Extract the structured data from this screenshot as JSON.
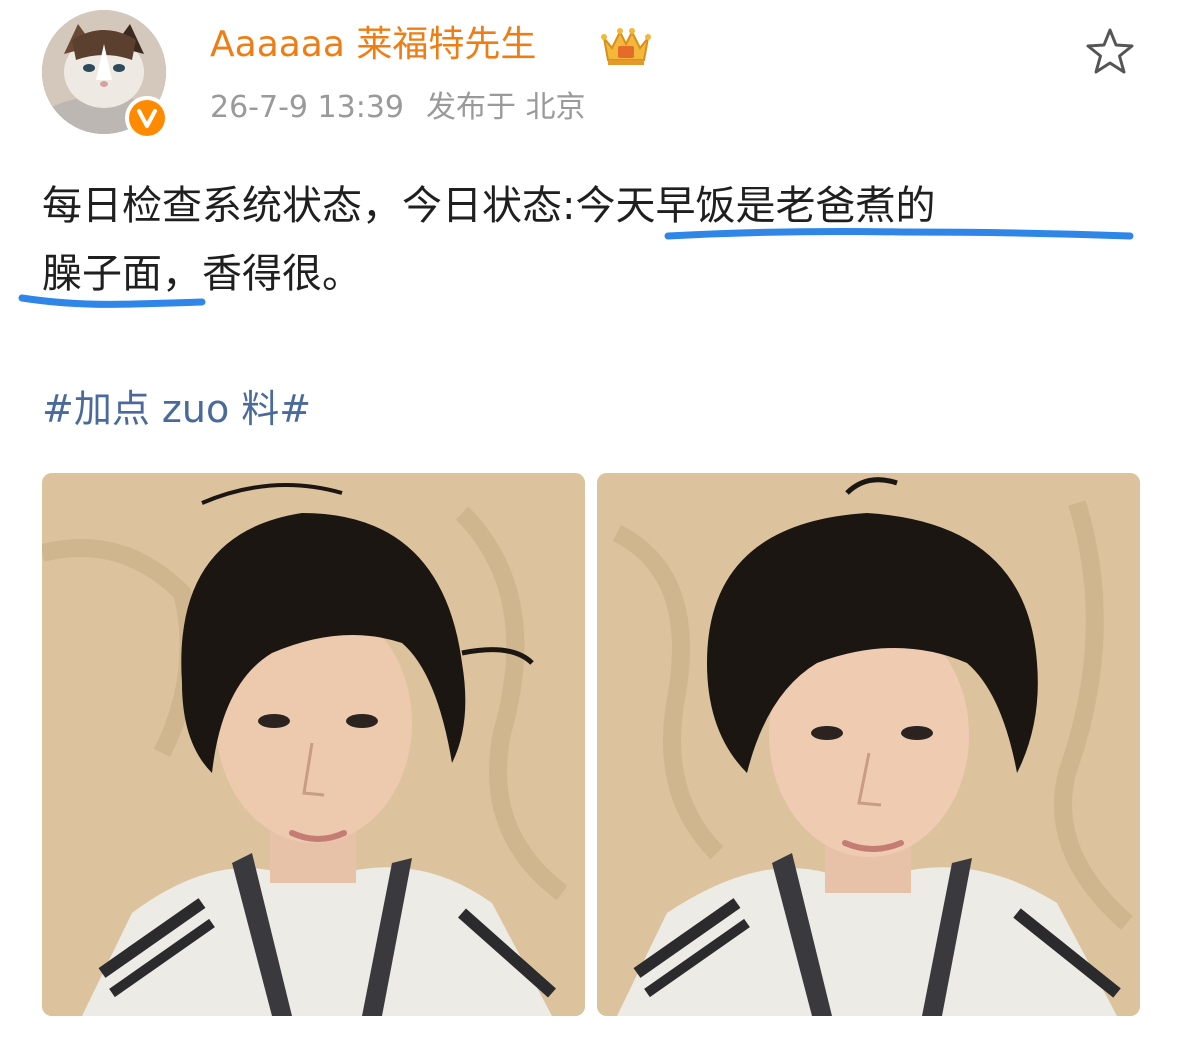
{
  "post": {
    "author": {
      "name": "Aaaaaa 莱福特先生",
      "avatar_icon": "cat-avatar",
      "verified_icon": "verified-v-icon",
      "verified_letter": "V",
      "member_icon": "crown-vip-icon"
    },
    "date": "26-7-9 13:39",
    "location": "发布于 北京",
    "text": {
      "part1": "每日检查系统状态，今日状态:",
      "highlighted_1": "今天早饭是老爸煮的",
      "highlighted_2": "臊子面，",
      "part2": "香得很。"
    },
    "hashtag": "#加点 zuo 料#",
    "images": [
      {
        "description_icon": "selfie-photo"
      },
      {
        "description_icon": "selfie-photo"
      }
    ]
  },
  "colors": {
    "username": "#f07d14",
    "meta": "#9a9a9a",
    "hashtag": "#4a6a9c",
    "underline": "#2f86e8",
    "verified": "#ff8a00"
  },
  "actions": {
    "favorite_icon": "star-outline-icon"
  }
}
